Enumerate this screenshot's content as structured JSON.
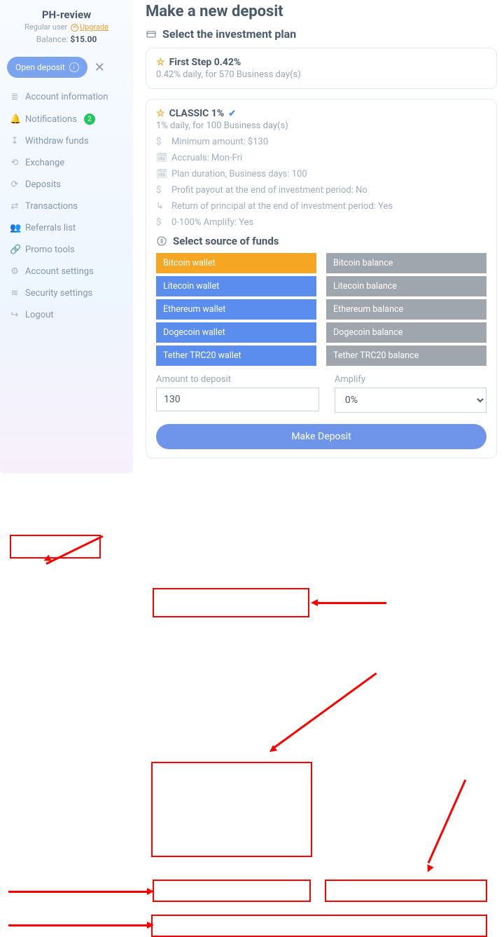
{
  "user": {
    "name": "PH-review",
    "type_prefix": "Regular user",
    "upgrade": "Upgrade",
    "balance_label": "Balance:",
    "balance_value": "$15.00"
  },
  "open_deposit_btn": "Open deposit",
  "menu": [
    {
      "icon": "≣",
      "label": "Account information"
    },
    {
      "icon": "🔔",
      "label": "Notifications",
      "badge": "2"
    },
    {
      "icon": "↧",
      "label": "Withdraw funds"
    },
    {
      "icon": "⟲",
      "label": "Exchange"
    },
    {
      "icon": "⟳",
      "label": "Deposits"
    },
    {
      "icon": "⇄",
      "label": "Transactions"
    },
    {
      "icon": "👥",
      "label": "Referrals list"
    },
    {
      "icon": "🔗",
      "label": "Promo tools"
    },
    {
      "icon": "⚙",
      "label": "Account settings"
    },
    {
      "icon": "≋",
      "label": "Security settings"
    },
    {
      "icon": "↪",
      "label": "Logout"
    }
  ],
  "page_title": "Make a new deposit",
  "select_plan_heading": "Select the investment plan",
  "plan_closed": {
    "title": "First Step 0.42%",
    "sub": "0.42% daily, for 570 Business day(s)"
  },
  "plan_open": {
    "title": "CLASSIC 1%",
    "sub": "1% daily, for 100 Business day(s)",
    "details": [
      {
        "icon": "$",
        "text": "Minimum amount: $130"
      },
      {
        "icon": "🗓",
        "text": "Accruals: Mon-Fri"
      },
      {
        "icon": "🗓",
        "text": "Plan duration, Business days: 100"
      },
      {
        "icon": "$",
        "text": "Profit payout at the end of investment period: No"
      },
      {
        "icon": "↳",
        "text": "Return of principal at the end of investment period: Yes"
      },
      {
        "icon": "$",
        "text": "0-100% Amplify: Yes"
      }
    ]
  },
  "sof_heading": "Select source of funds",
  "sof": {
    "wallets": [
      "Bitcoin wallet",
      "Litecoin wallet",
      "Ethereum wallet",
      "Dogecoin wallet",
      "Tether TRC20 wallet"
    ],
    "balances": [
      "Bitcoin balance",
      "Litecoin balance",
      "Ethereum balance",
      "Dogecoin balance",
      "Tether TRC20 balance"
    ]
  },
  "amount_label": "Amount to deposit",
  "amount_value": "130",
  "amplify_label": "Amplify",
  "amplify_value": "0%",
  "make_deposit": "Make Deposit"
}
